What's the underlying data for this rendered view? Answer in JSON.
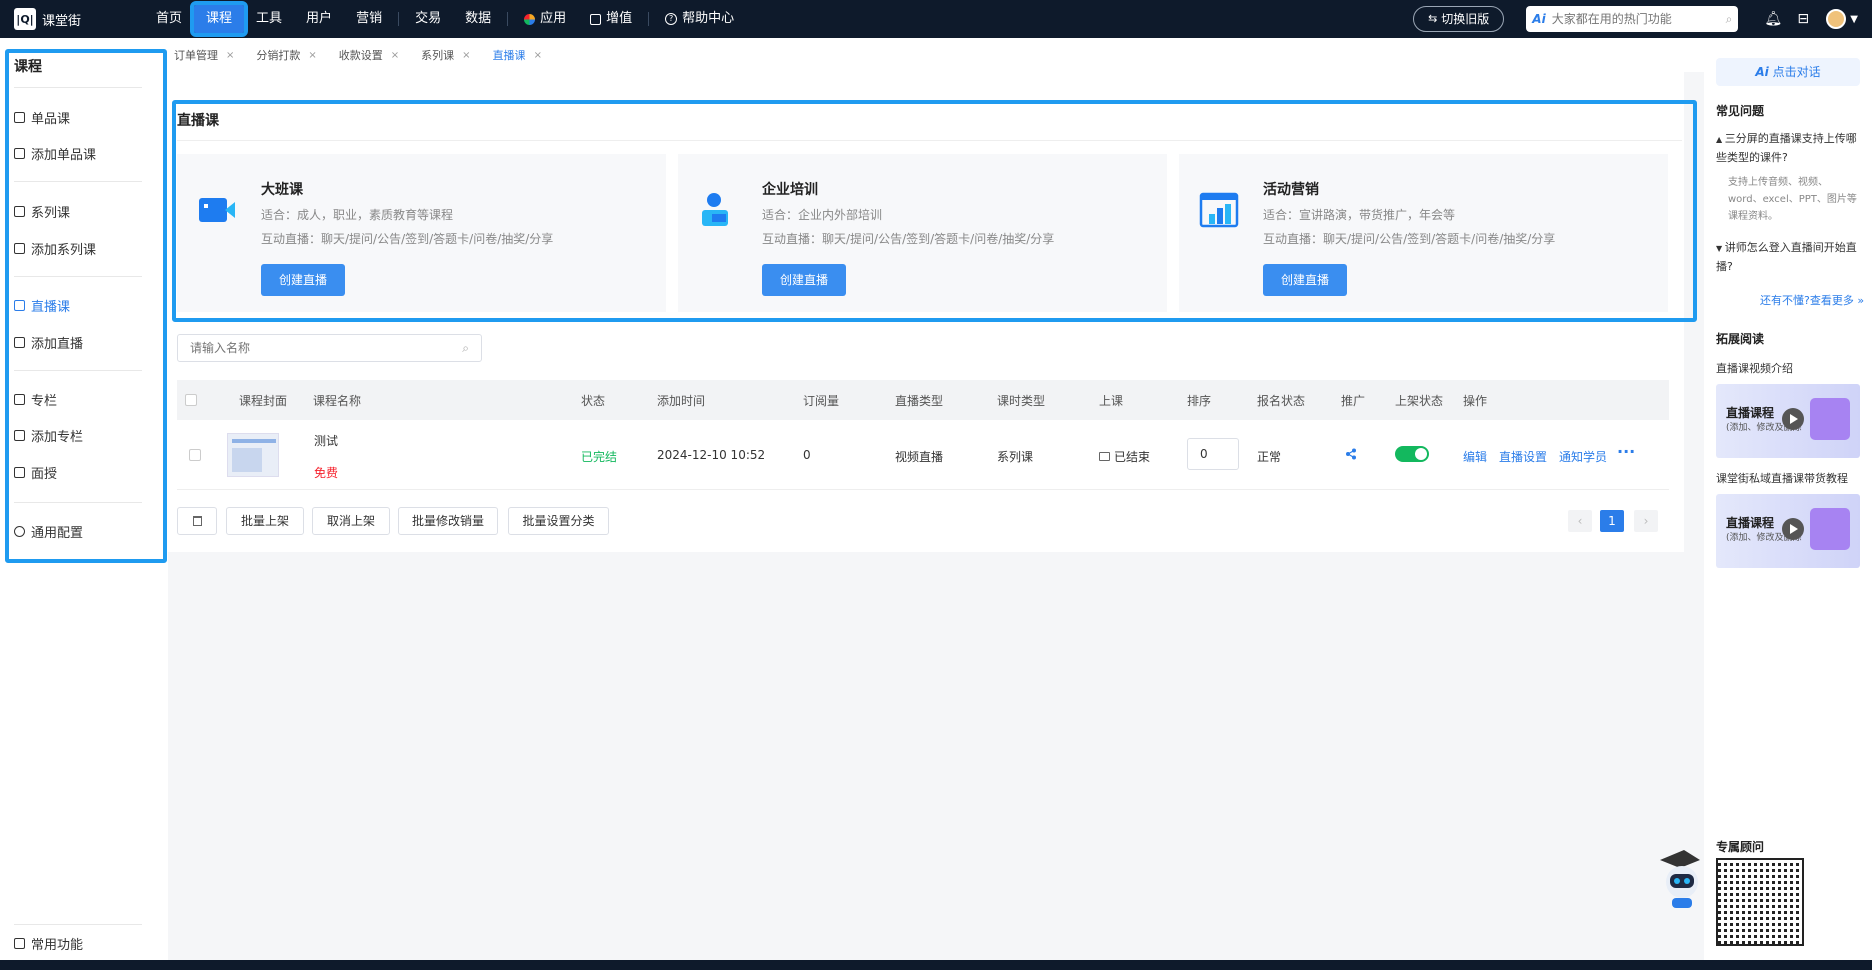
{
  "app": {
    "name": "课堂街"
  },
  "topnav": {
    "items": [
      "首页",
      "课程",
      "工具",
      "用户",
      "营销",
      "交易",
      "数据",
      "应用",
      "增值",
      "帮助中心"
    ],
    "switch_label": "切换旧版",
    "search_ai": "Ai",
    "search_placeholder": "大家都在用的热门功能"
  },
  "sidebar": {
    "title": "课程",
    "items": [
      "单品课",
      "添加单品课",
      "系列课",
      "添加系列课",
      "直播课",
      "添加直播",
      "专栏",
      "添加专栏",
      "面授",
      "通用配置"
    ],
    "bottom": "常用功能"
  },
  "tabs": [
    "订单管理",
    "分销打款",
    "收款设置",
    "系列课",
    "直播课"
  ],
  "section": {
    "title": "直播课",
    "cards": [
      {
        "title": "大班课",
        "desc": "适合：成人，职业，素质教育等课程",
        "desc2": "互动直播：聊天/提问/公告/签到/答题卡/问卷/抽奖/分享",
        "button": "创建直播"
      },
      {
        "title": "企业培训",
        "desc": "适合：企业内外部培训",
        "desc2": "互动直播：聊天/提问/公告/签到/答题卡/问卷/抽奖/分享",
        "button": "创建直播"
      },
      {
        "title": "活动营销",
        "desc": "适合：宣讲路演，带货推广，年会等",
        "desc2": "互动直播：聊天/提问/公告/签到/答题卡/问卷/抽奖/分享",
        "button": "创建直播"
      }
    ]
  },
  "filter": {
    "placeholder": "请输入名称"
  },
  "table": {
    "headers": [
      "课程封面",
      "课程名称",
      "状态",
      "添加时间",
      "订阅量",
      "直播类型",
      "课时类型",
      "上课",
      "排序",
      "报名状态",
      "推广",
      "上架状态",
      "操作"
    ],
    "row": {
      "name": "测试",
      "price": "免费",
      "status": "已完结",
      "added": "2024-12-10 10:52",
      "subs": "0",
      "live_type": "视频直播",
      "lesson_type": "系列课",
      "class_state": "已结束",
      "sort": "0",
      "signup": "正常",
      "ops": [
        "编辑",
        "直播设置",
        "通知学员"
      ]
    }
  },
  "footer": {
    "buttons": [
      "批量上架",
      "取消上架",
      "批量修改销量",
      "批量设置分类"
    ],
    "page": "1"
  },
  "right_panel": {
    "ai_button": "点击对话",
    "faq_title": "常见问题",
    "q1": "三分屏的直播课支持上传哪些类型的课件?",
    "a1": "支持上传音频、视频、word、excel、PPT、图片等课程资料。",
    "q2": "讲师怎么登入直播间开始直播?",
    "more": "还有不懂?查看更多 »",
    "reading_title": "拓展阅读",
    "link1": "直播课视频介绍",
    "link2": "课堂街私域直播课带货教程",
    "video_title": "直播课程",
    "video_sub": "(添加、修改及删除",
    "consult": "专属顾问"
  },
  "colors": {
    "accent": "#2b7de9",
    "highlight": "#1f9bf0",
    "nav_bg": "#0e1a2b",
    "success": "#13b85e",
    "danger": "#f5222d"
  }
}
